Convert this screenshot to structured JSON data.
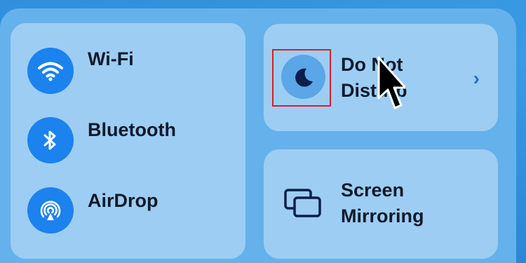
{
  "connectivity": {
    "wifi": {
      "label": "Wi-Fi",
      "icon": "wifi-icon"
    },
    "bluetooth": {
      "label": "Bluetooth",
      "icon": "bluetooth-icon"
    },
    "airdrop": {
      "label": "AirDrop",
      "icon": "airdrop-icon"
    }
  },
  "focus": {
    "label": "Do Not Disturb",
    "icon": "moon-icon",
    "chevron": "›"
  },
  "screen_mirroring": {
    "label": "Screen Mirroring",
    "icon": "screen-mirroring-icon"
  },
  "colors": {
    "accent": "#1b82ee",
    "tile": "#9dcdf3",
    "panel": "#65b1ec",
    "highlight": "#d4202a"
  }
}
